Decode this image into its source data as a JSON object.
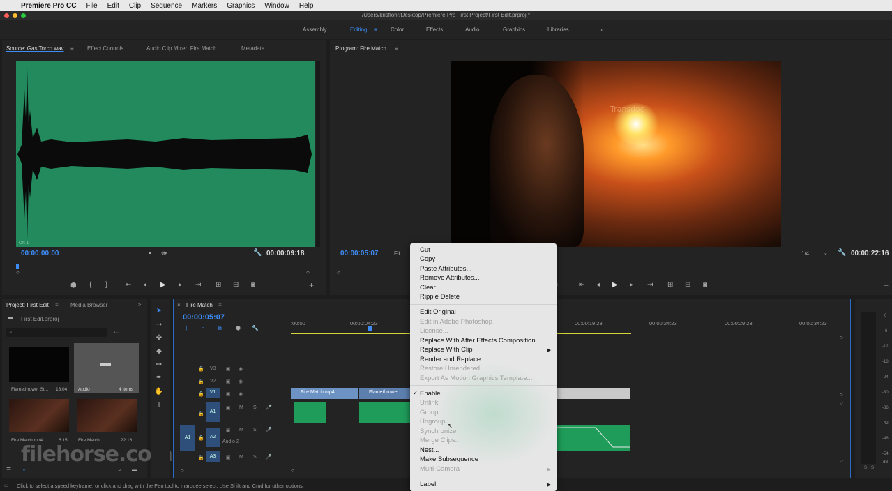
{
  "menubar": {
    "app_name": "Premiere Pro CC",
    "items": [
      "File",
      "Edit",
      "Clip",
      "Sequence",
      "Markers",
      "Graphics",
      "Window",
      "Help"
    ]
  },
  "window": {
    "title": "/Users/krisflohr/Desktop/Premiere Pro First Project/First Edit.prproj *"
  },
  "workspaces": {
    "items": [
      "Assembly",
      "Editing",
      "Color",
      "Effects",
      "Audio",
      "Graphics",
      "Libraries"
    ],
    "active": "Editing",
    "overflow": "»"
  },
  "source_panel": {
    "tabs": [
      "Source: Gas Torch.wav",
      "Effect Controls",
      "Audio Clip Mixer: Fire Match",
      "Metadata"
    ],
    "timecode_in": "00:00:00:00",
    "timecode_out": "00:00:09:18",
    "channel_label": "Ch: 1"
  },
  "program_panel": {
    "tab": "Program: Fire Match",
    "timecode_in": "00:00:05:07",
    "fit": "Fit",
    "resolution": "1/4",
    "timecode_out": "00:00:22:16",
    "video_text": "Transdoc"
  },
  "project_panel": {
    "tabs": [
      "Project: First Edit",
      "Media Browser"
    ],
    "file": "First Edit.prproj",
    "items": [
      {
        "name": "Flamethrower St...",
        "duration": "18:04"
      },
      {
        "name": "Audio",
        "duration": "4 Items"
      },
      {
        "name": "Fire Match.mp4",
        "duration": "6:15"
      },
      {
        "name": "Fire Match",
        "duration": "22:16"
      }
    ]
  },
  "timeline": {
    "tab": "Fire Match",
    "timecode": "00:00:05:07",
    "ruler": [
      ":00:00",
      "00:00:04:23",
      "00:00:19:23",
      "00:00:24:23",
      "00:00:29:23",
      "00:00:34:23"
    ],
    "tracks": {
      "video": [
        "V3",
        "V2",
        "V1"
      ],
      "audio": [
        "A1",
        "A2",
        "A3"
      ],
      "source_a1": "A1",
      "audio2_name": "Audio 2",
      "mute": "M",
      "solo": "S"
    },
    "clips": [
      "Fire Match.mp4",
      "Flamethrower"
    ]
  },
  "context_menu": {
    "items": [
      {
        "label": "Cut",
        "enabled": true
      },
      {
        "label": "Copy",
        "enabled": true
      },
      {
        "label": "Paste Attributes...",
        "enabled": true
      },
      {
        "label": "Remove Attributes...",
        "enabled": true
      },
      {
        "label": "Clear",
        "enabled": true
      },
      {
        "label": "Ripple Delete",
        "enabled": true
      },
      {
        "label": "Edit Original",
        "enabled": true
      },
      {
        "label": "Edit in Adobe Photoshop",
        "enabled": false
      },
      {
        "label": "License...",
        "enabled": false
      },
      {
        "label": "Replace With After Effects Composition",
        "enabled": true
      },
      {
        "label": "Replace With Clip",
        "enabled": true
      },
      {
        "label": "Render and Replace...",
        "enabled": true
      },
      {
        "label": "Restore Unrendered",
        "enabled": false
      },
      {
        "label": "Export As Motion Graphics Template...",
        "enabled": false
      },
      {
        "label": "Enable",
        "enabled": true,
        "checked": true
      },
      {
        "label": "Unlink",
        "enabled": false
      },
      {
        "label": "Group",
        "enabled": false
      },
      {
        "label": "Ungroup",
        "enabled": false
      },
      {
        "label": "Synchronize",
        "enabled": false
      },
      {
        "label": "Merge Clips...",
        "enabled": false
      },
      {
        "label": "Nest...",
        "enabled": true
      },
      {
        "label": "Make Subsequence",
        "enabled": true
      },
      {
        "label": "Multi-Camera",
        "enabled": false
      },
      {
        "label": "Label",
        "enabled": true
      }
    ],
    "checkmark": "✓"
  },
  "status_bar": {
    "text": "Click to select a speed keyframe, or click and drag with the Pen tool to marquee select. Use Shift and Cmd for other options."
  },
  "meters": {
    "labels": [
      "0",
      "-6",
      "-12",
      "-18",
      "-24",
      "-30",
      "-36",
      "-42",
      "-48",
      "-54",
      "dB"
    ],
    "solo": [
      "S",
      "S"
    ]
  },
  "watermark": "filehorse.com",
  "colors": {
    "accent": "#3d8cf5",
    "audio_green": "#1f9c5a",
    "video_clip": "#6c93c4",
    "waveform_bg": "#238a5e"
  }
}
